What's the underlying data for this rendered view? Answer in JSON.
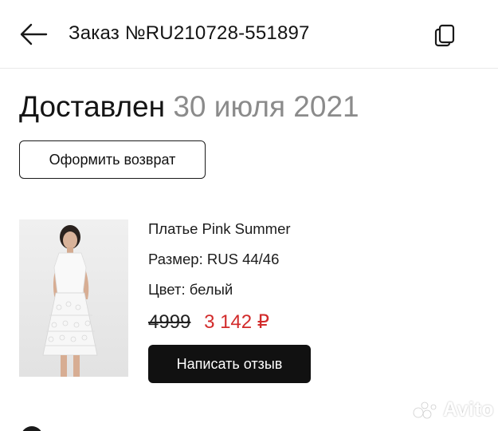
{
  "header": {
    "order_title": "Заказ №RU210728-551897",
    "back_icon": "arrow-left-icon",
    "copy_icon": "copy-icon"
  },
  "status": {
    "state": "Доставлен",
    "date": "30 июля 2021"
  },
  "actions": {
    "return_label": "Оформить возврат"
  },
  "product": {
    "name": "Платье Pink Summer",
    "size": "Размер: RUS 44/46",
    "color": "Цвет: белый",
    "price_old": "4999",
    "price_new": "3 142 ₽",
    "review_label": "Написать отзыв"
  },
  "watermark": {
    "text": "Avito"
  },
  "colors": {
    "accent_price": "#d22b2b",
    "primary_button": "#111111",
    "secondary_text": "#8b8b8b"
  }
}
